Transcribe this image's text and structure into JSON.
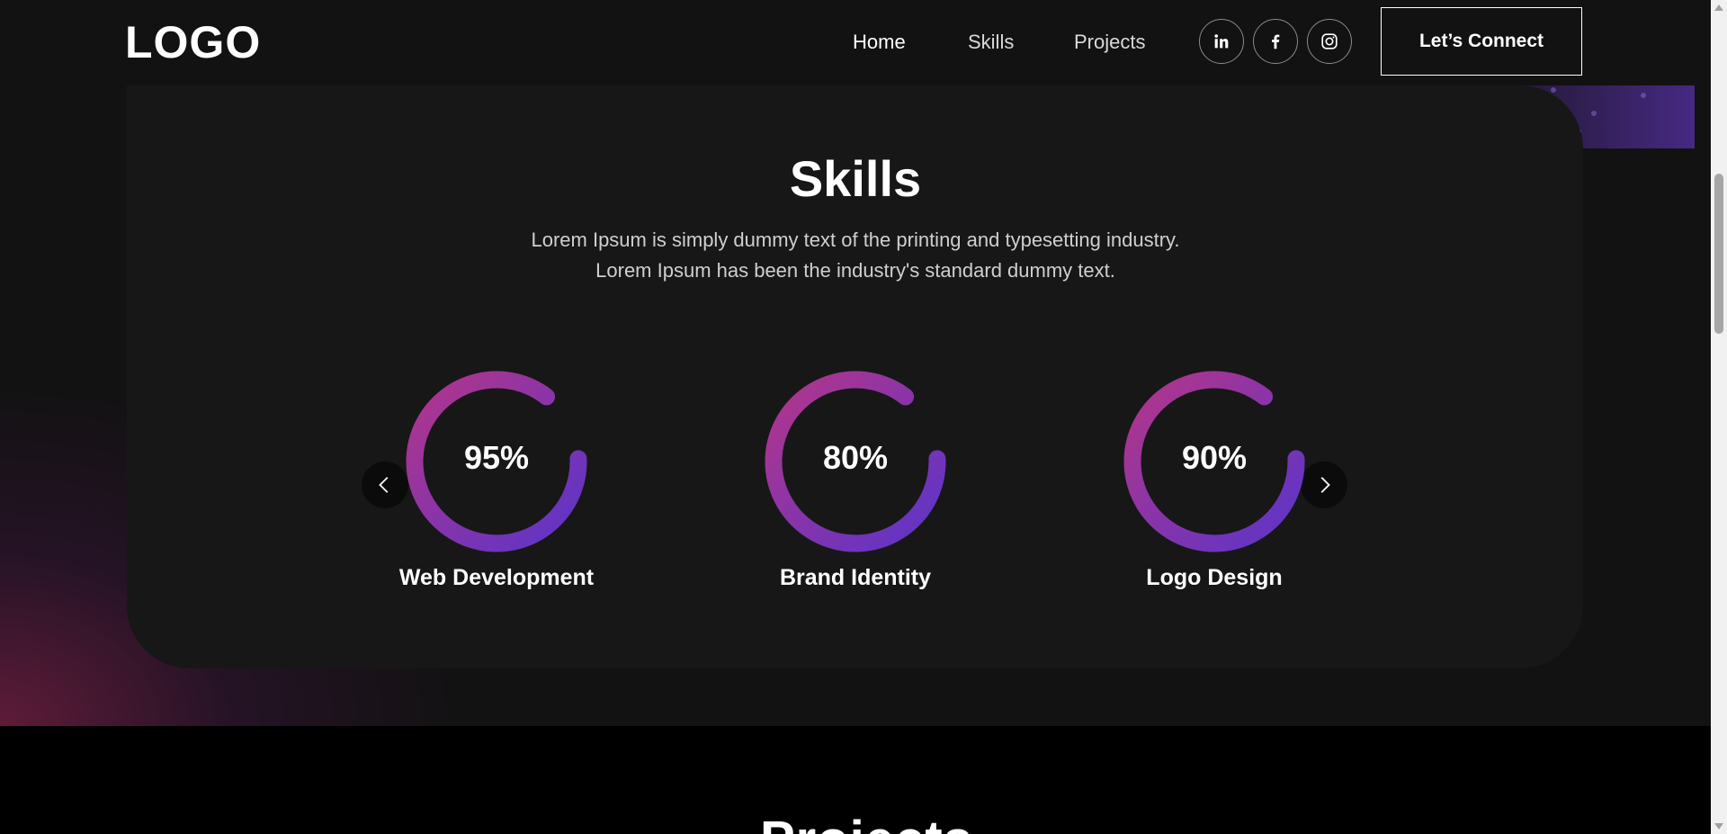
{
  "navbar": {
    "logo": "LOGO",
    "links": [
      "Home",
      "Skills",
      "Projects"
    ],
    "social_icons": [
      "linkedin-icon",
      "facebook-icon",
      "instagram-icon"
    ],
    "cta_label": "Let’s Connect"
  },
  "skills": {
    "title": "Skills",
    "description_line1": "Lorem Ipsum is simply dummy text of the printing and typesetting industry.",
    "description_line2": "Lorem Ipsum has been the industry's standard dummy text.",
    "items": [
      {
        "percent_label": "95%",
        "value": 0.95,
        "name": "Web Development"
      },
      {
        "percent_label": "80%",
        "value": 0.8,
        "name": "Brand Identity"
      },
      {
        "percent_label": "90%",
        "value": 0.9,
        "name": "Logo Design"
      }
    ],
    "prev_icon": "chevron-left-icon",
    "next_icon": "chevron-right-icon"
  },
  "next_section": {
    "title": "Projects"
  },
  "colors": {
    "gradient_start": "#b3358a",
    "gradient_end": "#5b34c9",
    "background": "#121212",
    "card": "#171717"
  }
}
